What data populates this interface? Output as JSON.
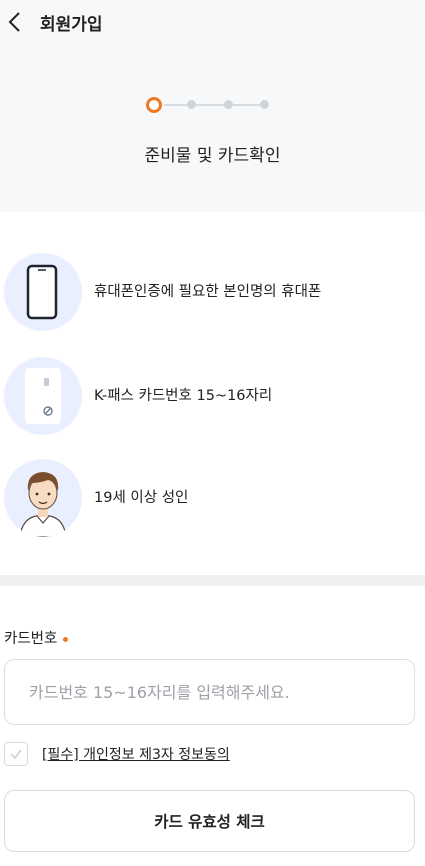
{
  "header": {
    "title": "회원가입"
  },
  "stepper": {
    "current_step": 1,
    "total_steps": 4,
    "title": "준비물 및 카드확인"
  },
  "requirements": [
    {
      "icon": "phone-icon",
      "text": "휴대폰인증에 필요한 본인명의 휴대폰"
    },
    {
      "icon": "kpass-card-icon",
      "text": "K-패스 카드번호 15~16자리"
    },
    {
      "icon": "adult-person-icon",
      "text": "19세 이상 성인"
    }
  ],
  "card_field": {
    "label": "카드번호",
    "placeholder": "카드번호 15~16자리를 입력해주세요.",
    "value": ""
  },
  "agreement": {
    "label": "[필수] 개인정보 제3자 정보동의",
    "checked": false
  },
  "submit": {
    "label": "카드 유효성 체크"
  },
  "colors": {
    "accent": "#ef7a26",
    "icon_bg": "#e9efff",
    "top_bg": "#f7f8fa"
  }
}
